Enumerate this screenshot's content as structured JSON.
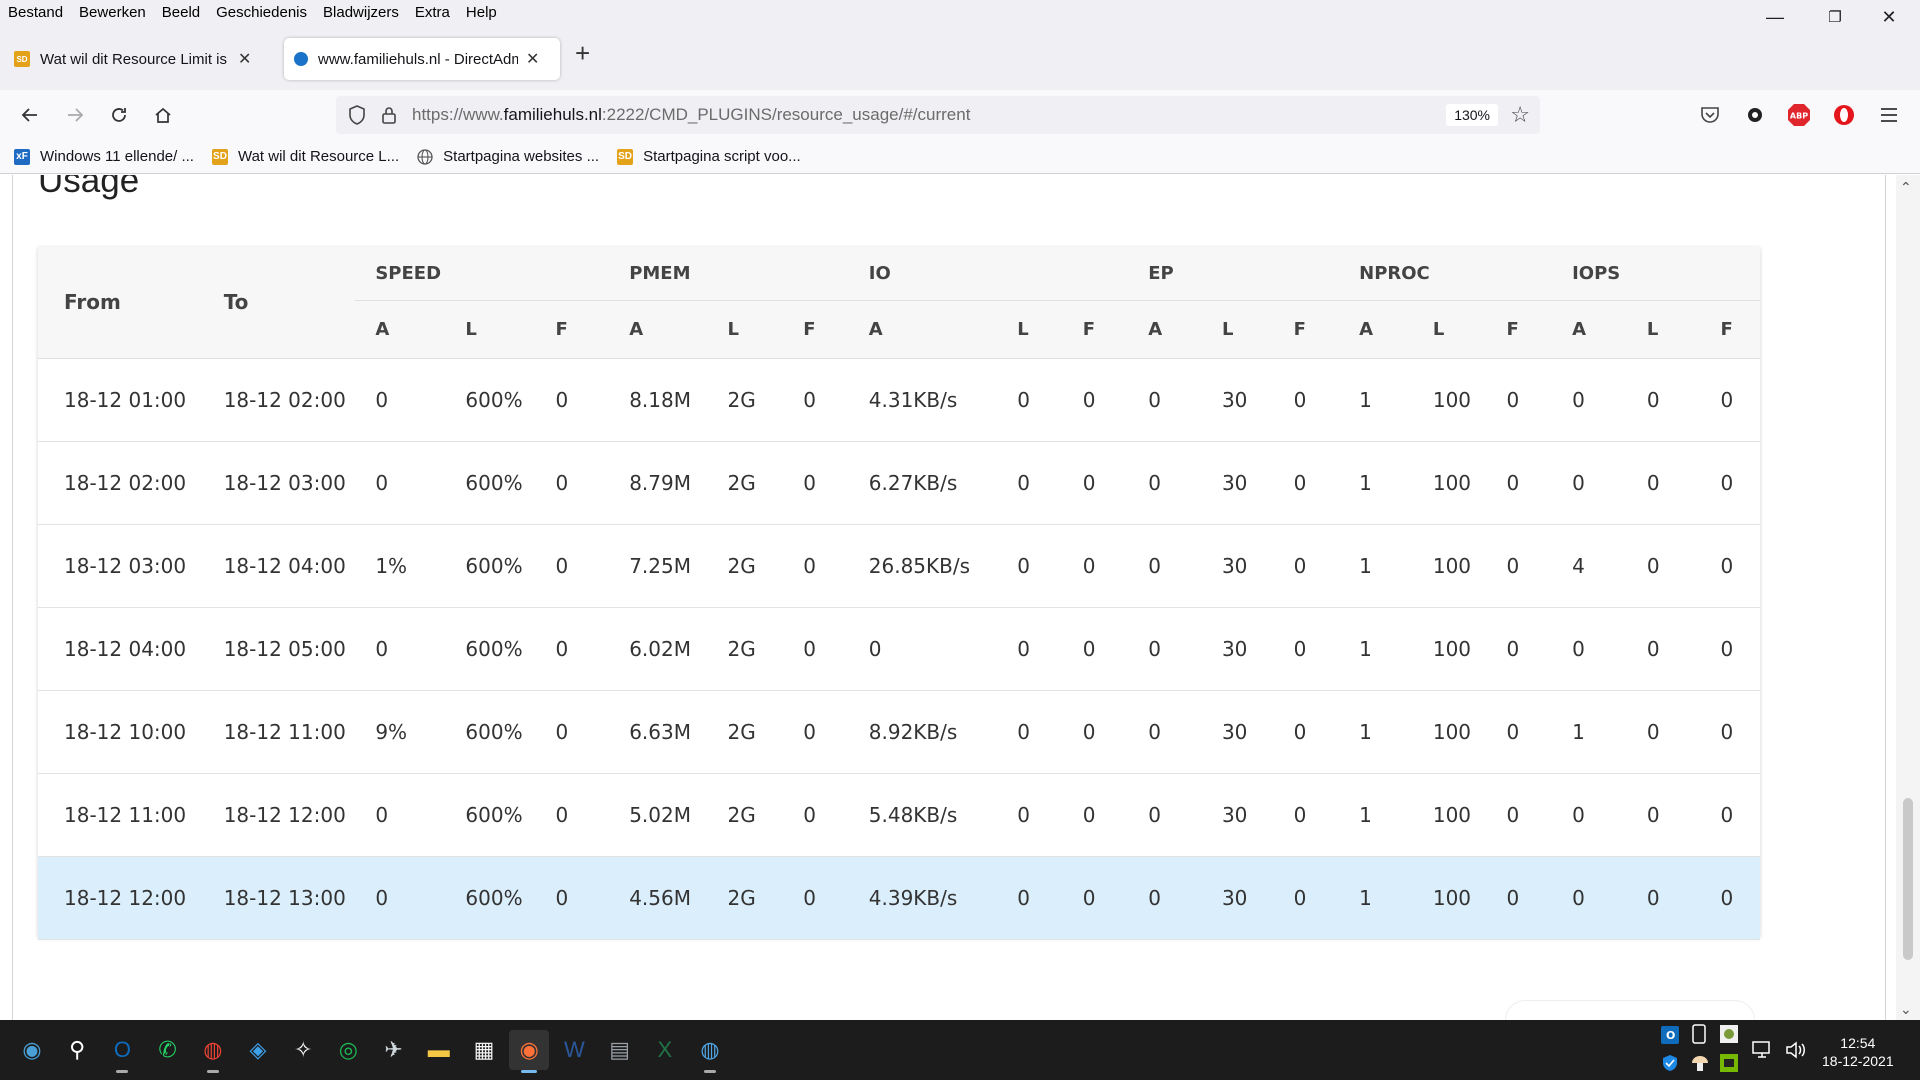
{
  "menu": [
    "Bestand",
    "Bewerken",
    "Beeld",
    "Geschiedenis",
    "Bladwijzers",
    "Extra",
    "Help"
  ],
  "window_controls": {
    "minimize": "—",
    "restore": "❐",
    "close": "✕"
  },
  "tabs": [
    {
      "title": "Wat wil dit Resource Limit is Re",
      "active": false,
      "favicon": "sd-favicon",
      "close": "✕"
    },
    {
      "title": "www.familiehuls.nl - DirectAdm",
      "active": true,
      "favicon": "directadmin-favicon",
      "close": "✕"
    }
  ],
  "new_tab": "+",
  "address": {
    "prefix": "https://www.",
    "host": "familiehuls.nl",
    "path": ":2222/CMD_PLUGINS/resource_usage/#/current",
    "zoom": "130%"
  },
  "bookmarks": [
    {
      "label": "Windows 11 ellende/ ...",
      "icon": "xf-icon",
      "icon_text": "xF",
      "color": "#1f6bc4"
    },
    {
      "label": "Wat wil dit Resource L...",
      "icon": "sd-icon",
      "icon_text": "SD",
      "color": "#e3a21a"
    },
    {
      "label": "Startpagina websites ...",
      "icon": "globe-icon",
      "icon_text": "",
      "color": "#555555"
    },
    {
      "label": "Startpagina script voo...",
      "icon": "sd-icon",
      "icon_text": "SD",
      "color": "#e3a21a"
    }
  ],
  "page_title": "Usage",
  "table": {
    "from_label": "From",
    "to_label": "To",
    "groups": [
      "SPEED",
      "PMEM",
      "IO",
      "EP",
      "NPROC",
      "IOPS"
    ],
    "sub": [
      "A",
      "L",
      "F"
    ],
    "rows": [
      {
        "from": "18-12 01:00",
        "to": "18-12 02:00",
        "vals": [
          "0",
          "600%",
          "0",
          "8.18M",
          "2G",
          "0",
          "4.31KB/s",
          "0",
          "0",
          "0",
          "30",
          "0",
          "1",
          "100",
          "0",
          "0",
          "0",
          "0"
        ]
      },
      {
        "from": "18-12 02:00",
        "to": "18-12 03:00",
        "vals": [
          "0",
          "600%",
          "0",
          "8.79M",
          "2G",
          "0",
          "6.27KB/s",
          "0",
          "0",
          "0",
          "30",
          "0",
          "1",
          "100",
          "0",
          "0",
          "0",
          "0"
        ]
      },
      {
        "from": "18-12 03:00",
        "to": "18-12 04:00",
        "vals": [
          "1%",
          "600%",
          "0",
          "7.25M",
          "2G",
          "0",
          "26.85KB/s",
          "0",
          "0",
          "0",
          "30",
          "0",
          "1",
          "100",
          "0",
          "4",
          "0",
          "0"
        ]
      },
      {
        "from": "18-12 04:00",
        "to": "18-12 05:00",
        "vals": [
          "0",
          "600%",
          "0",
          "6.02M",
          "2G",
          "0",
          "0",
          "0",
          "0",
          "0",
          "30",
          "0",
          "1",
          "100",
          "0",
          "0",
          "0",
          "0"
        ]
      },
      {
        "from": "18-12 10:00",
        "to": "18-12 11:00",
        "vals": [
          "9%",
          "600%",
          "0",
          "6.63M",
          "2G",
          "0",
          "8.92KB/s",
          "0",
          "0",
          "0",
          "30",
          "0",
          "1",
          "100",
          "0",
          "1",
          "0",
          "0"
        ]
      },
      {
        "from": "18-12 11:00",
        "to": "18-12 12:00",
        "vals": [
          "0",
          "600%",
          "0",
          "5.02M",
          "2G",
          "0",
          "5.48KB/s",
          "0",
          "0",
          "0",
          "30",
          "0",
          "1",
          "100",
          "0",
          "0",
          "0",
          "0"
        ]
      },
      {
        "from": "18-12 12:00",
        "to": "18-12 13:00",
        "vals": [
          "0",
          "600%",
          "0",
          "4.56M",
          "2G",
          "0",
          "4.39KB/s",
          "0",
          "0",
          "0",
          "30",
          "0",
          "1",
          "100",
          "0",
          "0",
          "0",
          "0"
        ],
        "selected": true
      }
    ]
  },
  "taskbar": {
    "apps": [
      {
        "name": "start-button",
        "glyph": "◉",
        "color": "#4a9fd5"
      },
      {
        "name": "search-icon",
        "glyph": "⚲",
        "color": "#ffffff"
      },
      {
        "name": "outlook-icon",
        "glyph": "O",
        "color": "#0f6cbd"
      },
      {
        "name": "whatsapp-icon",
        "glyph": "✆",
        "color": "#25d366"
      },
      {
        "name": "chrome-icon",
        "glyph": "◍",
        "color": "#e94235"
      },
      {
        "name": "remote-icon",
        "glyph": "◈",
        "color": "#3ea0e8"
      },
      {
        "name": "fox-icon",
        "glyph": "✧",
        "color": "#ffffff"
      },
      {
        "name": "spotify-icon",
        "glyph": "◎",
        "color": "#1db954"
      },
      {
        "name": "plane-icon",
        "glyph": "✈",
        "color": "#cfd8dc"
      },
      {
        "name": "file-explorer-icon",
        "glyph": "▬",
        "color": "#f6c744"
      },
      {
        "name": "store-icon",
        "glyph": "▦",
        "color": "#f3f3f3"
      },
      {
        "name": "firefox-icon",
        "glyph": "◉",
        "color": "#ff7139",
        "active": true
      },
      {
        "name": "word-icon",
        "glyph": "W",
        "color": "#2b579a"
      },
      {
        "name": "calculator-icon",
        "glyph": "▤",
        "color": "#9aa0a6"
      },
      {
        "name": "excel-icon",
        "glyph": "X",
        "color": "#217346"
      },
      {
        "name": "globe-app-icon",
        "glyph": "◍",
        "color": "#4fa3e0"
      }
    ],
    "time": "12:54",
    "date": "18-12-2021"
  }
}
